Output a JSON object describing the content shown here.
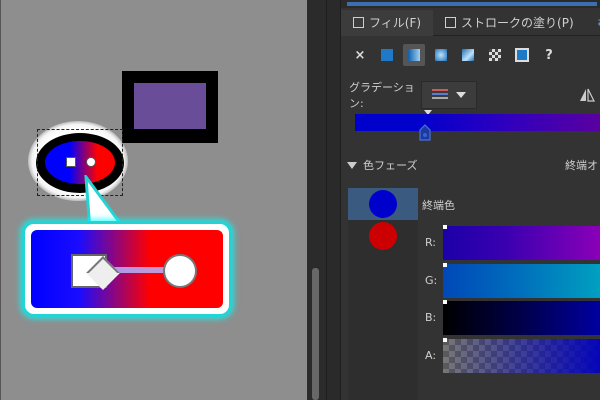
{
  "canvas": {
    "page_color": "#8e8e8e",
    "rect_stroke": "#000000",
    "rect_fill": "#6a4d98",
    "ellipse_gradient": [
      "#0000ff",
      "#ff0000"
    ],
    "callout_border": "#22d4d4"
  },
  "panel": {
    "tabs": [
      {
        "label": "フィル(F)",
        "icon": "checkbox-icon"
      },
      {
        "label": "ストロークの塗り(P)",
        "icon": "checkbox-icon"
      },
      {
        "label": "ス",
        "icon": "swap-icon"
      }
    ],
    "fill_types": {
      "close_label": "×",
      "help_label": "?"
    },
    "gradient": {
      "label": "グラデーション:",
      "bar_colors": [
        "#0000cc",
        "#5a00a0"
      ]
    },
    "phases": {
      "label": "色フェーズ",
      "end_opacity_label": "終端オ",
      "end_color_label": "終端色",
      "stops": [
        {
          "color": "#0000cc",
          "selected": true
        },
        {
          "color": "#cc0000",
          "selected": false
        }
      ]
    },
    "channels": [
      {
        "label": "R:"
      },
      {
        "label": "G:"
      },
      {
        "label": "B:"
      },
      {
        "label": "A:"
      }
    ]
  }
}
